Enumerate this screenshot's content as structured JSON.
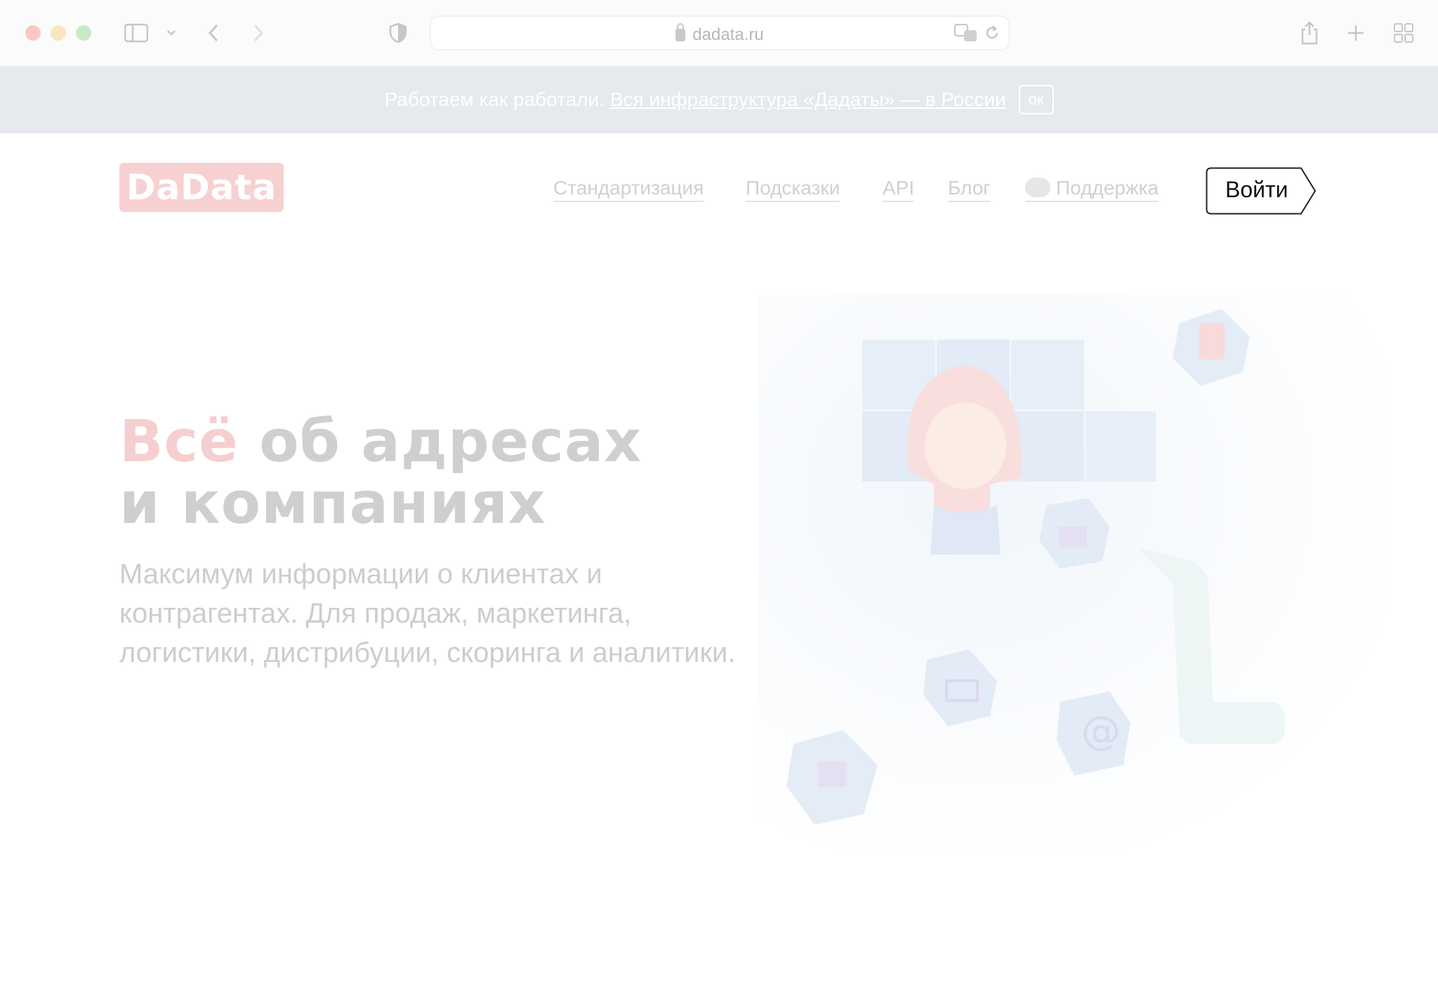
{
  "browser": {
    "url": "dadata.ru",
    "icons": [
      "sidebar-icon",
      "chevron-down-icon",
      "back-icon",
      "forward-icon",
      "shield-icon",
      "translate-icon",
      "reload-icon",
      "share-icon",
      "plus-icon",
      "tabs-grid-icon"
    ]
  },
  "banner": {
    "text": "Работаем как работали.",
    "link": "Вся инфраструктура «Дадаты» — в России",
    "ok_label": "ок"
  },
  "header": {
    "logo": "DaData",
    "nav": [
      {
        "label": "Стандартизация"
      },
      {
        "label": "Подсказки"
      },
      {
        "label": "API"
      },
      {
        "label": "Блог"
      },
      {
        "label": "Поддержка"
      }
    ],
    "login_label": "Войти"
  },
  "hero": {
    "title_accent": "Всё",
    "title_rest_line1": "об адресах",
    "title_line2": "и компаниях",
    "subtitle": "Максимум информации о клиентах и контрагентах. Для продаж, маркетинга, логистики, дистрибуции, скоринга и аналитики."
  },
  "colors": {
    "brand_accent": "#f7d1d1",
    "banner_bg": "#e6e9ed",
    "text_faded": "#cfcfcf"
  }
}
